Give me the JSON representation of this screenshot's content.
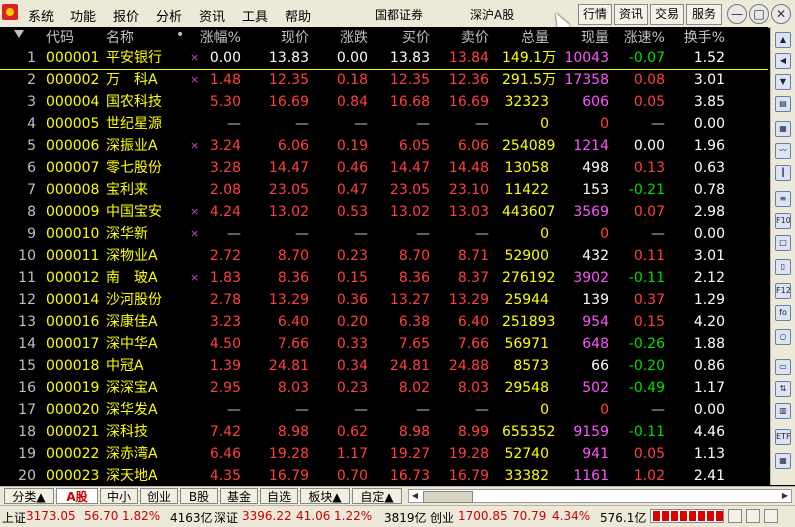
{
  "menu": {
    "items": [
      "系统",
      "功能",
      "报价",
      "分析",
      "资讯",
      "工具",
      "帮助"
    ],
    "broker": "国都证券",
    "market_title": "深沪A股",
    "buttons": [
      "行情",
      "资讯",
      "交易",
      "服务"
    ]
  },
  "table": {
    "headers": {
      "code": "代码",
      "name": "名称",
      "dot": "•",
      "pct": "涨幅%",
      "price": "现价",
      "change": "涨跌",
      "bid": "买价",
      "ask": "卖价",
      "volume": "总量",
      "cur_vol": "现量",
      "speed": "涨速%",
      "turnover": "换手%"
    },
    "rows": [
      {
        "idx": "1",
        "code": "000001",
        "name": "平安银行",
        "mark": "×",
        "pct": "0.00",
        "price": "13.83",
        "change": "0.00",
        "bid": "13.83",
        "ask": "13.84",
        "volume": "149.1万",
        "cur_vol": "10043",
        "speed": "-0.07",
        "turnover": "1.52",
        "tone": "white"
      },
      {
        "idx": "2",
        "code": "000002",
        "name": "万　科A",
        "mark": "×",
        "pct": "1.48",
        "price": "12.35",
        "change": "0.18",
        "bid": "12.35",
        "ask": "12.36",
        "volume": "291.5万",
        "cur_vol": "17358",
        "speed": "0.08",
        "turnover": "3.01",
        "tone": "red"
      },
      {
        "idx": "3",
        "code": "000004",
        "name": "国农科技",
        "mark": "",
        "pct": "5.30",
        "price": "16.69",
        "change": "0.84",
        "bid": "16.68",
        "ask": "16.69",
        "volume": "32323",
        "cur_vol": "606",
        "speed": "0.05",
        "turnover": "3.85",
        "tone": "red"
      },
      {
        "idx": "4",
        "code": "000005",
        "name": "世纪星源",
        "mark": "",
        "pct": "—",
        "price": "—",
        "change": "—",
        "bid": "—",
        "ask": "—",
        "volume": "0",
        "cur_vol": "0",
        "speed": "—",
        "turnover": "0.00",
        "tone": "grey"
      },
      {
        "idx": "5",
        "code": "000006",
        "name": "深振业A",
        "mark": "×",
        "pct": "3.24",
        "price": "6.06",
        "change": "0.19",
        "bid": "6.05",
        "ask": "6.06",
        "volume": "254089",
        "cur_vol": "1214",
        "speed": "0.00",
        "turnover": "1.96",
        "tone": "red"
      },
      {
        "idx": "6",
        "code": "000007",
        "name": "零七股份",
        "mark": "",
        "pct": "3.28",
        "price": "14.47",
        "change": "0.46",
        "bid": "14.47",
        "ask": "14.48",
        "volume": "13058",
        "cur_vol": "498",
        "speed": "0.13",
        "turnover": "0.63",
        "tone": "red"
      },
      {
        "idx": "7",
        "code": "000008",
        "name": "宝利来",
        "mark": "",
        "pct": "2.08",
        "price": "23.05",
        "change": "0.47",
        "bid": "23.05",
        "ask": "23.10",
        "volume": "11422",
        "cur_vol": "153",
        "speed": "-0.21",
        "turnover": "0.78",
        "tone": "red"
      },
      {
        "idx": "8",
        "code": "000009",
        "name": "中国宝安",
        "mark": "×",
        "pct": "4.24",
        "price": "13.02",
        "change": "0.53",
        "bid": "13.02",
        "ask": "13.03",
        "volume": "443607",
        "cur_vol": "3569",
        "speed": "0.07",
        "turnover": "2.98",
        "tone": "red"
      },
      {
        "idx": "9",
        "code": "000010",
        "name": "深华新",
        "mark": "×",
        "pct": "—",
        "price": "—",
        "change": "—",
        "bid": "—",
        "ask": "—",
        "volume": "0",
        "cur_vol": "0",
        "speed": "—",
        "turnover": "0.00",
        "tone": "grey"
      },
      {
        "idx": "10",
        "code": "000011",
        "name": "深物业A",
        "mark": "",
        "pct": "2.72",
        "price": "8.70",
        "change": "0.23",
        "bid": "8.70",
        "ask": "8.71",
        "volume": "52900",
        "cur_vol": "432",
        "speed": "0.11",
        "turnover": "3.01",
        "tone": "red"
      },
      {
        "idx": "11",
        "code": "000012",
        "name": "南　玻A",
        "mark": "×",
        "pct": "1.83",
        "price": "8.36",
        "change": "0.15",
        "bid": "8.36",
        "ask": "8.37",
        "volume": "276192",
        "cur_vol": "3902",
        "speed": "-0.11",
        "turnover": "2.12",
        "tone": "red"
      },
      {
        "idx": "12",
        "code": "000014",
        "name": "沙河股份",
        "mark": "",
        "pct": "2.78",
        "price": "13.29",
        "change": "0.36",
        "bid": "13.27",
        "ask": "13.29",
        "volume": "25944",
        "cur_vol": "139",
        "speed": "0.37",
        "turnover": "1.29",
        "tone": "red"
      },
      {
        "idx": "13",
        "code": "000016",
        "name": "深康佳A",
        "mark": "",
        "pct": "3.23",
        "price": "6.40",
        "change": "0.20",
        "bid": "6.38",
        "ask": "6.40",
        "volume": "251893",
        "cur_vol": "954",
        "speed": "0.15",
        "turnover": "4.20",
        "tone": "red"
      },
      {
        "idx": "14",
        "code": "000017",
        "name": "深中华A",
        "mark": "",
        "pct": "4.50",
        "price": "7.66",
        "change": "0.33",
        "bid": "7.65",
        "ask": "7.66",
        "volume": "56971",
        "cur_vol": "648",
        "speed": "-0.26",
        "turnover": "1.88",
        "tone": "red"
      },
      {
        "idx": "15",
        "code": "000018",
        "name": "中冠A",
        "mark": "",
        "pct": "1.39",
        "price": "24.81",
        "change": "0.34",
        "bid": "24.81",
        "ask": "24.88",
        "volume": "8573",
        "cur_vol": "66",
        "speed": "-0.20",
        "turnover": "0.86",
        "tone": "red"
      },
      {
        "idx": "16",
        "code": "000019",
        "name": "深深宝A",
        "mark": "",
        "pct": "2.95",
        "price": "8.03",
        "change": "0.23",
        "bid": "8.02",
        "ask": "8.03",
        "volume": "29548",
        "cur_vol": "502",
        "speed": "-0.49",
        "turnover": "1.17",
        "tone": "red"
      },
      {
        "idx": "17",
        "code": "000020",
        "name": "深华发A",
        "mark": "",
        "pct": "—",
        "price": "—",
        "change": "—",
        "bid": "—",
        "ask": "—",
        "volume": "0",
        "cur_vol": "0",
        "speed": "—",
        "turnover": "0.00",
        "tone": "grey"
      },
      {
        "idx": "18",
        "code": "000021",
        "name": "深科技",
        "mark": "",
        "pct": "7.42",
        "price": "8.98",
        "change": "0.62",
        "bid": "8.98",
        "ask": "8.99",
        "volume": "655352",
        "cur_vol": "9159",
        "speed": "-0.11",
        "turnover": "4.46",
        "tone": "red"
      },
      {
        "idx": "19",
        "code": "000022",
        "name": "深赤湾A",
        "mark": "",
        "pct": "6.46",
        "price": "19.28",
        "change": "1.17",
        "bid": "19.27",
        "ask": "19.28",
        "volume": "52740",
        "cur_vol": "941",
        "speed": "0.05",
        "turnover": "1.13",
        "tone": "red"
      },
      {
        "idx": "20",
        "code": "000023",
        "name": "深天地A",
        "mark": "",
        "pct": "4.35",
        "price": "16.79",
        "change": "0.70",
        "bid": "16.73",
        "ask": "16.79",
        "volume": "33382",
        "cur_vol": "1161",
        "speed": "1.02",
        "turnover": "2.41",
        "tone": "red"
      }
    ]
  },
  "tabs": [
    "分类▲",
    "A股",
    "中小",
    "创业",
    "B股",
    "基金",
    "自选",
    "板块▲",
    "自定▲"
  ],
  "status": {
    "sh_label": "上证",
    "sh_index": "3173.05",
    "sh_change": "56.70",
    "sh_pct": "1.82%",
    "sh_amount": "4163亿",
    "sz_label": "深证",
    "sz_index": "3396.22",
    "sz_change": "41.06",
    "sz_pct": "1.22%",
    "sz_amount": "3819亿",
    "cy_label": "创业",
    "cy_index": "1700.85",
    "cy_change": "70.79",
    "cy_pct": "4.34%",
    "cy_amount": "576.1亿"
  },
  "sidebar_icons": [
    "arrow-up-icon",
    "arrow-left-icon",
    "arrow-down-icon",
    "report-icon",
    "table-icon",
    "line-chart-icon",
    "candlestick-icon",
    "list-icon",
    "f10-icon",
    "book-icon",
    "page-icon",
    "f12-icon",
    "fo-icon",
    "circle-icon",
    "folder-icon",
    "transfer-icon",
    "chart-icon",
    "etf-icon",
    "grid-icon"
  ],
  "colors": {
    "up": "#ff4040",
    "down": "#00e000",
    "flat": "#ffffff",
    "code": "#ffff00",
    "volume": "#ffff00",
    "cur_vol": "#ff55ff"
  }
}
